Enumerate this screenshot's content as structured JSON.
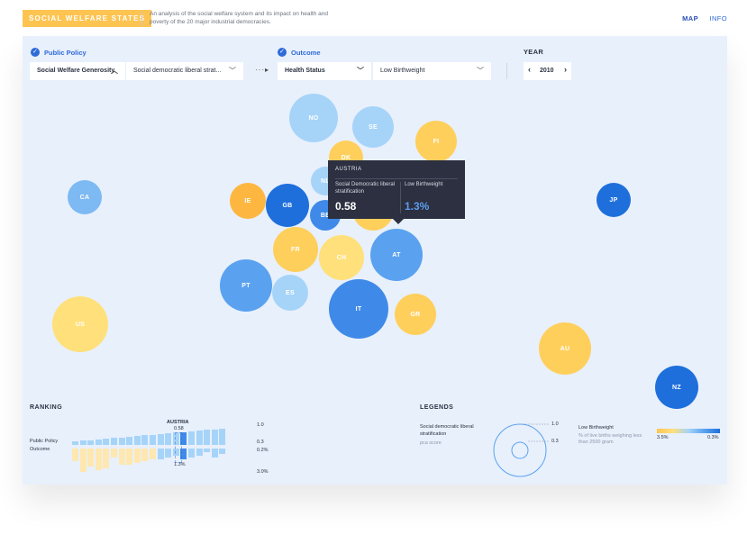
{
  "header": {
    "brand": "SOCIAL WELFARE STATES",
    "description": "An analysis of the social welfare system and its impact on health and poverty of the 20 major industrial democracies.",
    "nav": [
      "MAP",
      "INFO"
    ]
  },
  "controls": {
    "policy_label": "Public Policy",
    "policy_category": "Social Welfare Generosity",
    "policy_measure": "Social democratic liberal strat...",
    "outcome_label": "Outcome",
    "outcome_category": "Health Status",
    "outcome_measure": "Low Birthweight",
    "year_label": "YEAR",
    "year_value": "2010"
  },
  "colors": {
    "blue_dark": "#1e6fdc",
    "blue_mid": "#5aa2ef",
    "blue_light": "#a6d4f8",
    "yellow_light": "#ffe07a",
    "yellow_mid": "#ffcf5c",
    "orange": "#fdb740"
  },
  "bubbles": [
    {
      "code": "NO",
      "color": "#a6d4f8"
    },
    {
      "code": "SE",
      "color": "#a6d4f8"
    },
    {
      "code": "FI",
      "color": "#ffcf5c"
    },
    {
      "code": "DK",
      "color": "#ffcf5c"
    },
    {
      "code": "CA",
      "color": "#7db9f3"
    },
    {
      "code": "IE",
      "color": "#fdb740"
    },
    {
      "code": "GB",
      "color": "#1e6fdc"
    },
    {
      "code": "NL",
      "color": "#a6d4f8"
    },
    {
      "code": "BE",
      "color": "#3f8ae8"
    },
    {
      "code": "DE",
      "color": "#ffcf5c"
    },
    {
      "code": "JP",
      "color": "#1e6fdc"
    },
    {
      "code": "FR",
      "color": "#ffcf5c"
    },
    {
      "code": "CH",
      "color": "#ffe07a"
    },
    {
      "code": "AT",
      "color": "#5aa2ef"
    },
    {
      "code": "PT",
      "color": "#5aa2ef"
    },
    {
      "code": "ES",
      "color": "#a6d4f8"
    },
    {
      "code": "IT",
      "color": "#3f8ae8"
    },
    {
      "code": "GR",
      "color": "#ffcf5c"
    },
    {
      "code": "US",
      "color": "#ffe07a"
    },
    {
      "code": "AU",
      "color": "#ffcf5c"
    },
    {
      "code": "NZ",
      "color": "#1e6fdc"
    }
  ],
  "tooltip": {
    "country": "AUSTRIA",
    "policy_label": "Social Democratic liberal stratification",
    "outcome_label": "Low Birthweight",
    "policy_value": "0.58",
    "outcome_value": "1.3%"
  },
  "ranking": {
    "title": "RANKING",
    "row_policy": "Public Policy",
    "row_outcome": "Outcome",
    "highlight_country": "AUSTRIA",
    "highlight_policy": "0.58",
    "highlight_outcome": "1.3%",
    "axis_policy_max": "1.0",
    "axis_policy_min": "0.3",
    "axis_outcome_min": "0.2%",
    "axis_outcome_max": "3.0%"
  },
  "legends": {
    "title": "LEGENDS",
    "size_label": "Social democratic liberal stratification",
    "size_sub": "pca score",
    "size_max": "1.0",
    "size_min": "0.3",
    "color_label": "Low Birthweight",
    "color_sub": "% of live births weighing less than 2500 gram",
    "color_left": "3.5%",
    "color_right": "0.3%"
  }
}
